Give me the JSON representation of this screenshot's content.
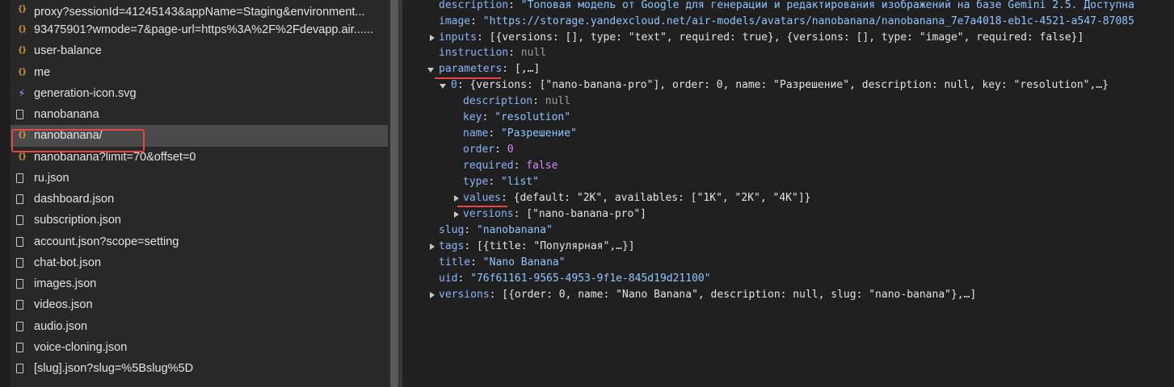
{
  "requests": [
    {
      "name": "proxy?sessionId=41245143&appName=Staging&environment...",
      "icon": "xhr-icon"
    },
    {
      "name": "93475901?wmode=7&page-url=https%3A%2F%2Fdevapp.air......",
      "icon": "xhr-icon"
    },
    {
      "name": "user-balance",
      "icon": "xhr-icon"
    },
    {
      "name": "me",
      "icon": "xhr-icon"
    },
    {
      "name": "generation-icon.svg",
      "icon": "svg-icon"
    },
    {
      "name": "nanobanana",
      "icon": "document-icon"
    },
    {
      "name": "nanobanana/",
      "icon": "xhr-icon",
      "selected": true
    },
    {
      "name": "nanobanana?limit=70&offset=0",
      "icon": "xhr-icon"
    },
    {
      "name": "ru.json",
      "icon": "document-icon"
    },
    {
      "name": "dashboard.json",
      "icon": "document-icon"
    },
    {
      "name": "subscription.json",
      "icon": "document-icon"
    },
    {
      "name": "account.json?scope=setting",
      "icon": "document-icon"
    },
    {
      "name": "chat-bot.json",
      "icon": "document-icon"
    },
    {
      "name": "images.json",
      "icon": "document-icon"
    },
    {
      "name": "videos.json",
      "icon": "document-icon"
    },
    {
      "name": "audio.json",
      "icon": "document-icon"
    },
    {
      "name": "voice-cloning.json",
      "icon": "document-icon"
    },
    {
      "name": "[slug].json?slug=%5Bslug%5D",
      "icon": "document-icon"
    }
  ],
  "preview": {
    "description": {
      "key": "description",
      "value": "\"Топовая модель от Google для генерации и редактирования изображений на базе Gemini 2.5. Доступна"
    },
    "image": {
      "key": "image",
      "value": "\"https://storage.yandexcloud.net/air-models/avatars/nanobanana/nanobanana_7e7a4018-eb1c-4521-a547-87085"
    },
    "inputs": {
      "key": "inputs",
      "value": "[{versions: [], type: \"text\", required: true}, {versions: [], type: \"image\", required: false}]"
    },
    "instruction": {
      "key": "instruction",
      "value": "null"
    },
    "parameters": {
      "key": "parameters",
      "value": "[,…]"
    },
    "param0": {
      "key": "0",
      "value": "{versions: [\"nano-banana-pro\"], order: 0, name: \"Разрешение\", description: null, key: \"resolution\",…}"
    },
    "p_description": {
      "key": "description",
      "value": "null"
    },
    "p_key": {
      "key": "key",
      "value": "\"resolution\""
    },
    "p_name": {
      "key": "name",
      "value": "\"Разрешение\""
    },
    "p_order": {
      "key": "order",
      "value": "0"
    },
    "p_required": {
      "key": "required",
      "value": "false"
    },
    "p_type": {
      "key": "type",
      "value": "\"list\""
    },
    "p_values": {
      "key": "values",
      "value": "{default: \"2K\", availables: [\"1K\", \"2K\", \"4K\"]}"
    },
    "p_versions": {
      "key": "versions",
      "value": "[\"nano-banana-pro\"]"
    },
    "slug": {
      "key": "slug",
      "value": "\"nanobanana\""
    },
    "tags": {
      "key": "tags",
      "value": "[{title: \"Популярная\",…}]"
    },
    "title": {
      "key": "title",
      "value": "\"Nano Banana\""
    },
    "uid": {
      "key": "uid",
      "value": "\"76f61161-9565-4953-9f1e-845d19d21100\""
    },
    "versions": {
      "key": "versions",
      "value": "[{order: 0, name: \"Nano Banana\", description: null, slug: \"nano-banana\"},…]"
    }
  }
}
